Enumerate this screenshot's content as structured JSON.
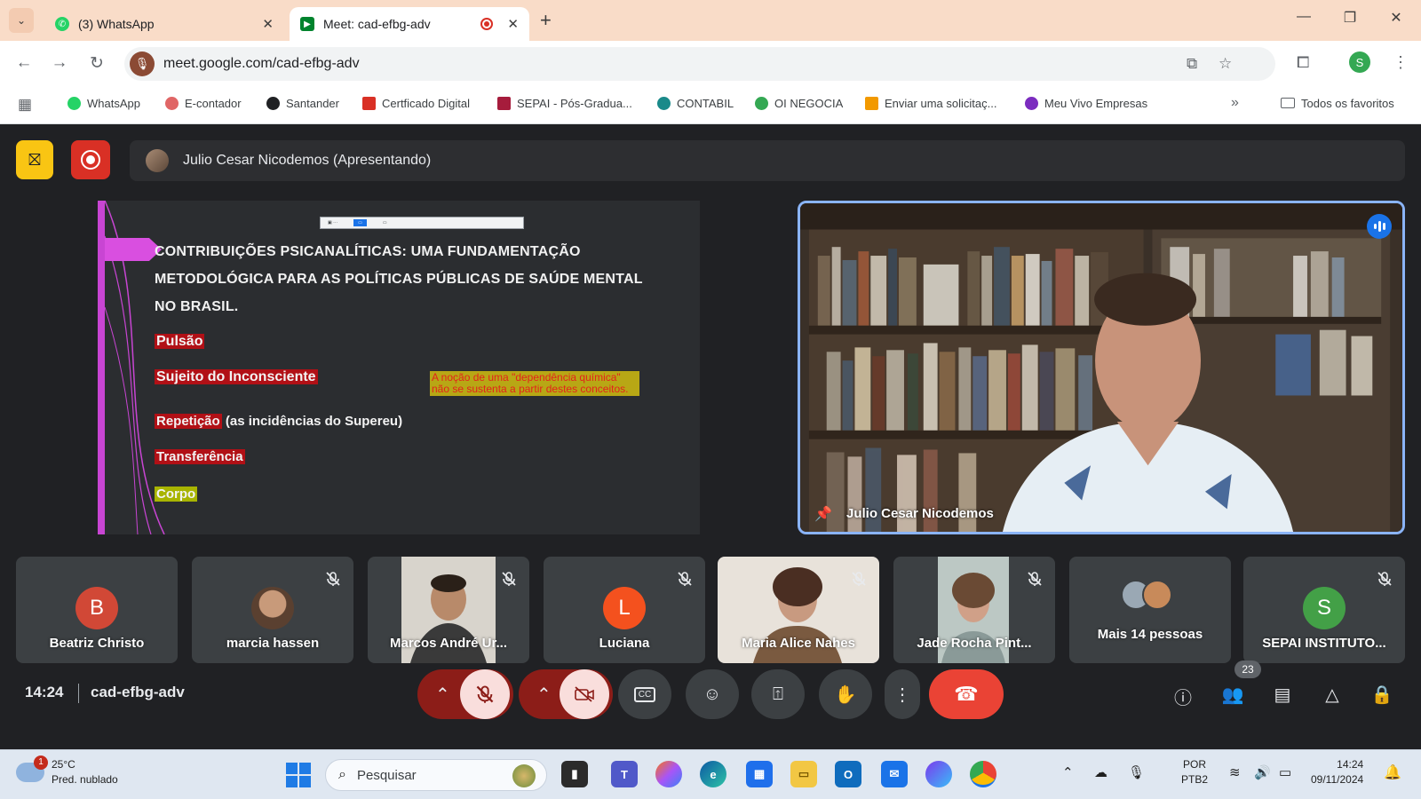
{
  "browser": {
    "tabs": [
      {
        "title": "(3) WhatsApp",
        "icon": "whatsapp-icon",
        "active": false
      },
      {
        "title": "Meet: cad-efbg-adv",
        "icon": "meet-icon",
        "active": true
      }
    ],
    "url": "meet.google.com/cad-efbg-adv",
    "profile_initial": "S",
    "bookmarks": [
      {
        "label": "WhatsApp",
        "color": "#25d366"
      },
      {
        "label": "E-contador",
        "color": "#e06666"
      },
      {
        "label": "Santander",
        "color": "#202124"
      },
      {
        "label": "Certficado Digital",
        "color": "#d93025"
      },
      {
        "label": "SEPAI - Pós-Gradua...",
        "color": "#a61c3c"
      },
      {
        "label": "CONTABIL",
        "color": "#1a8a8a"
      },
      {
        "label": "OI NEGOCIA",
        "color": "#34a853"
      },
      {
        "label": "Enviar uma solicitaç...",
        "color": "#f29900"
      },
      {
        "label": "Meu Vivo Empresas",
        "color": "#7b2cbf"
      }
    ],
    "all_bookmarks": "Todos os favoritos"
  },
  "meet": {
    "presenter_banner": "Julio Cesar Nicodemos (Apresentando)",
    "slide": {
      "title": "CONTRIBUIÇÕES PSICANALÍTICAS: UMA FUNDAMENTAÇÃO METODOLÓGICA PARA AS POLÍTICAS PÚBLICAS DE SAÚDE MENTAL NO BRASIL.",
      "items": {
        "pulsao": "Pulsão",
        "sujeito": "Sujeito do Inconsciente",
        "repeticao": "Repetição",
        "repeticao_note": " (as incidências do Supereu)",
        "transferencia": "Transferência",
        "corpo": "Corpo"
      },
      "note": "A noção de uma \"dependência química\" não se sustenta a partir destes conceitos."
    },
    "main_video_name": "Julio Cesar Nicodemos",
    "participants": [
      {
        "name": "Beatriz Christo",
        "initial": "B",
        "color": "#d14836",
        "muted": false
      },
      {
        "name": "marcia hassen",
        "initial": "",
        "color": "",
        "muted": true
      },
      {
        "name": "Marcos André Ur...",
        "initial": "",
        "color": "",
        "muted": true
      },
      {
        "name": "Luciana",
        "initial": "L",
        "color": "#f4511e",
        "muted": true
      },
      {
        "name": "Maria Alice Nahes",
        "initial": "",
        "color": "",
        "muted": true
      },
      {
        "name": "Jade Rocha Pint...",
        "initial": "",
        "color": "",
        "muted": true
      },
      {
        "name": "Mais 14 pessoas",
        "initial": "",
        "color": "",
        "muted": false
      },
      {
        "name": "SEPAI INSTITUTO...",
        "initial": "S",
        "color": "#43a047",
        "muted": true
      }
    ],
    "time": "14:24",
    "code": "cad-efbg-adv",
    "people_count": "23"
  },
  "taskbar": {
    "temperature": "25°C",
    "weather": "Pred. nublado",
    "weather_alert": "1",
    "search_placeholder": "Pesquisar",
    "lang1": "POR",
    "lang2": "PTB2",
    "time": "14:24",
    "date": "09/11/2024"
  }
}
